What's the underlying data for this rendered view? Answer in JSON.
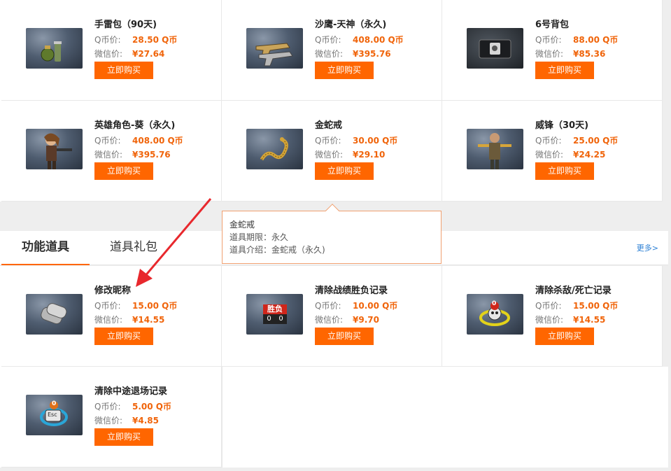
{
  "labels": {
    "q_price": "Q币价:",
    "wx_price": "微信价:",
    "buy": "立即购买"
  },
  "top_items": [
    {
      "name": "手雷包（90天)",
      "q": "28.50 Q币",
      "wx": "¥27.64",
      "icon": "grenade-pack-icon"
    },
    {
      "name": "沙鹰-天神（永久)",
      "q": "408.00 Q币",
      "wx": "¥395.76",
      "icon": "desert-eagle-icon"
    },
    {
      "name": "6号背包",
      "q": "88.00 Q币",
      "wx": "¥85.36",
      "icon": "backpack-icon"
    },
    {
      "name": "英雄角色-葵（永久)",
      "q": "408.00 Q币",
      "wx": "¥395.76",
      "icon": "hero-character-icon"
    },
    {
      "name": "金蛇戒",
      "q": "30.00 Q币",
      "wx": "¥29.10",
      "icon": "golden-snake-ring-icon"
    },
    {
      "name": "威锋（30天)",
      "q": "25.00 Q币",
      "wx": "¥24.25",
      "icon": "soldier-character-icon"
    }
  ],
  "tooltip": {
    "title": "金蛇戒",
    "period": "道具期限：永久",
    "intro": "道具介绍：金蛇戒（永久)"
  },
  "tabs": {
    "functional": "功能道具",
    "gift": "道具礼包",
    "more": "更多>"
  },
  "bottom_items": [
    {
      "name": "修改昵称",
      "q": "15.00 Q币",
      "wx": "¥14.55",
      "icon": "dog-tag-icon"
    },
    {
      "name": "清除战绩胜负记录",
      "q": "10.00 Q币",
      "wx": "¥9.70",
      "icon": "win-loss-scoreboard-icon",
      "badge_a": "胜",
      "badge_b": "负",
      "digit": "0"
    },
    {
      "name": "清除杀敌/死亡记录",
      "q": "15.00 Q币",
      "wx": "¥14.55",
      "icon": "kill-death-skull-icon",
      "digit": "0"
    },
    {
      "name": "清除中途退场记录",
      "q": "5.00 Q币",
      "wx": "¥4.85",
      "icon": "esc-key-icon",
      "key": "Esc",
      "digit": "0"
    }
  ],
  "colors": {
    "accent": "#ff6600",
    "price": "#f0640a",
    "link": "#2b7fd4",
    "arrow": "#e8282d"
  }
}
